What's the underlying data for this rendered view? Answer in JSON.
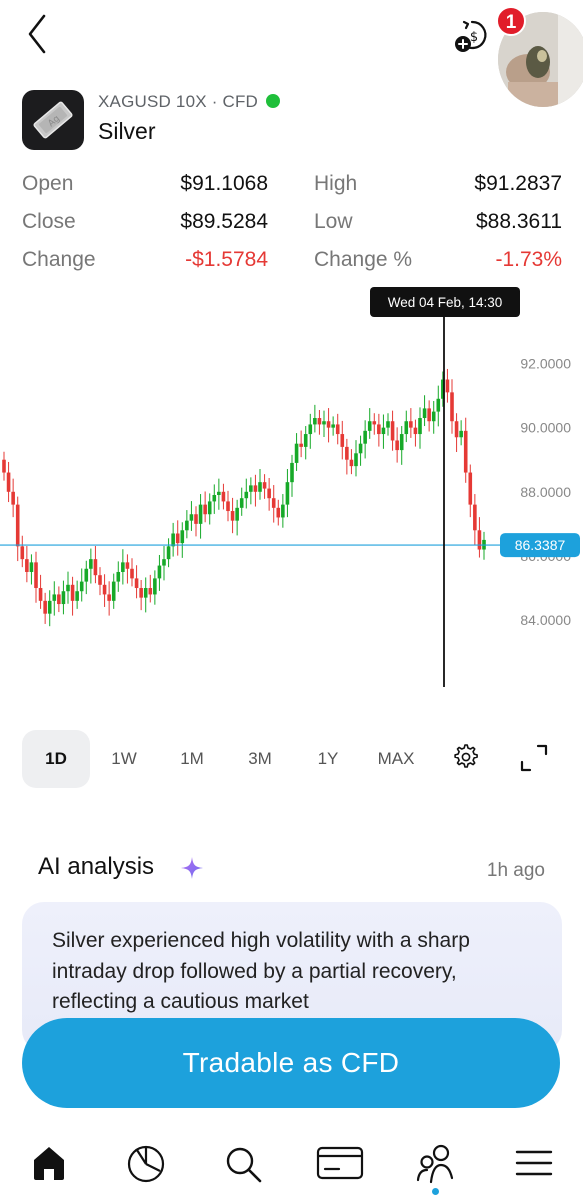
{
  "header": {
    "notification_count": "1"
  },
  "instrument": {
    "symbol_line": "XAGUSD 10X · CFD",
    "name": "Silver",
    "logo_text": "Ag",
    "status_color": "#1fbf3a"
  },
  "stats": {
    "open_label": "Open",
    "open_value": "$91.1068",
    "high_label": "High",
    "high_value": "$91.2837",
    "close_label": "Close",
    "close_value": "$89.5284",
    "low_label": "Low",
    "low_value": "$88.3611",
    "change_label": "Change",
    "change_value": "-$1.5784",
    "change_pct_label": "Change %",
    "change_pct_value": "-1.73%"
  },
  "chart": {
    "tooltip": "Wed 04 Feb, 14:30",
    "y_ticks": [
      "92.0000",
      "90.0000",
      "88.0000",
      "86.0000",
      "84.0000"
    ],
    "current_price": "86.3387",
    "up_color": "#16a928",
    "down_color": "#e53935",
    "price_line_color": "#1da1dc"
  },
  "chart_data": {
    "type": "candlestick",
    "title": "",
    "ylim": [
      82.6,
      93.2
    ],
    "y_ticks": [
      92,
      90,
      88,
      86,
      84
    ],
    "current_price": 86.3387,
    "crosshair_label": "Wed 04 Feb, 14:30",
    "close_values": [
      88.6,
      88.0,
      87.6,
      86.3,
      85.9,
      85.5,
      85.8,
      85.0,
      84.6,
      84.2,
      84.6,
      84.8,
      84.5,
      84.9,
      85.1,
      84.6,
      84.9,
      85.2,
      85.6,
      85.9,
      85.4,
      85.1,
      84.8,
      84.6,
      85.2,
      85.5,
      85.8,
      85.6,
      85.3,
      85.0,
      84.7,
      85.0,
      84.8,
      85.3,
      85.7,
      85.9,
      86.3,
      86.7,
      86.4,
      86.8,
      87.1,
      87.3,
      87.0,
      87.6,
      87.3,
      87.7,
      87.9,
      88.0,
      87.7,
      87.4,
      87.1,
      87.5,
      87.8,
      88.0,
      88.2,
      88.0,
      88.3,
      88.1,
      87.8,
      87.5,
      87.2,
      87.6,
      88.3,
      88.9,
      89.5,
      89.4,
      89.8,
      90.1,
      90.3,
      90.1,
      90.2,
      90.0,
      90.1,
      89.8,
      89.4,
      89.0,
      88.8,
      89.2,
      89.5,
      89.9,
      90.2,
      90.1,
      89.8,
      90.0,
      90.2,
      89.6,
      89.3,
      89.8,
      90.2,
      90.0,
      89.8,
      90.3,
      90.6,
      90.2,
      90.5,
      90.9,
      91.5,
      91.1,
      90.2,
      89.7,
      89.9,
      88.6,
      87.6,
      86.8,
      86.2,
      86.5
    ]
  },
  "ranges": {
    "items": [
      "1D",
      "1W",
      "1M",
      "3M",
      "1Y",
      "MAX"
    ],
    "active": "1D"
  },
  "ai": {
    "title": "AI analysis",
    "time": "1h ago",
    "text": "Silver experienced high volatility with a sharp intraday drop followed by a partial recovery, reflecting a cautious market"
  },
  "cta": {
    "label": "Tradable as CFD"
  },
  "nav": {
    "items": [
      "home-icon",
      "portfolio-pie-icon",
      "search-icon",
      "card-icon",
      "community-icon",
      "menu-icon"
    ]
  }
}
